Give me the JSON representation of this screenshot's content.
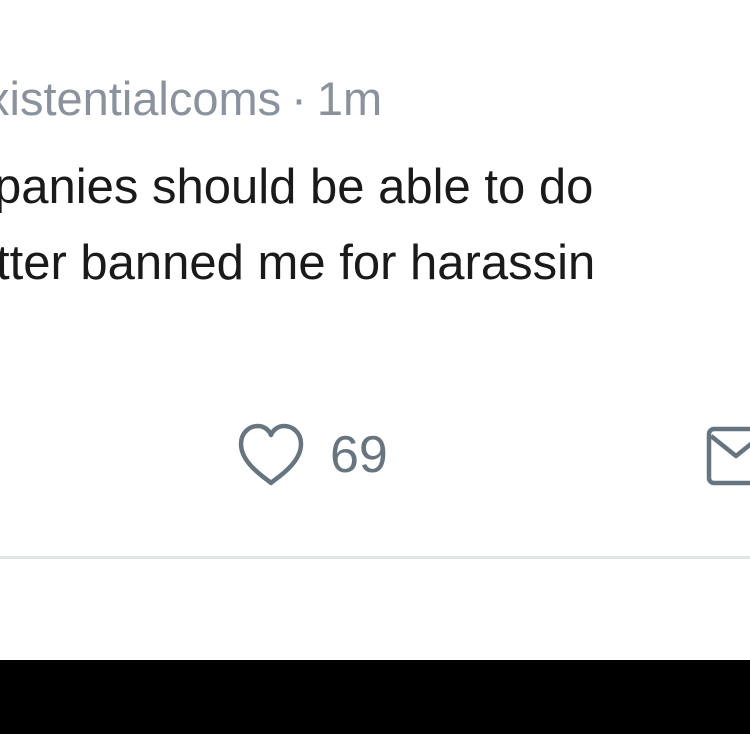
{
  "tweet": {
    "handle_fragment": "xistentialcoms",
    "separator": "·",
    "timestamp": "1m",
    "text_lines": [
      "panies should be able to do",
      "tter banned me for harassin"
    ]
  },
  "actions": {
    "like_icon": "heart-icon",
    "like_count": "69",
    "message_icon": "envelope-icon"
  },
  "colors": {
    "background": "#ffffff",
    "text": "#1a1a1a",
    "muted": "#8a939d",
    "icon": "#66757f",
    "divider": "#e3e6e9",
    "bottom_bar": "#000000"
  }
}
